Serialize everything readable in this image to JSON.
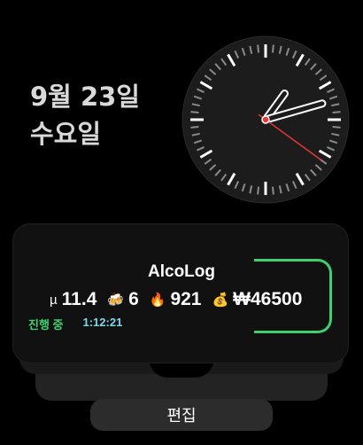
{
  "date": {
    "day": "9월 23일",
    "weekday": "수요일"
  },
  "clock": {
    "hours": 1,
    "minutes": 12,
    "seconds": 21,
    "accent": "#e53935"
  },
  "widget": {
    "title": "AlcoLog",
    "stats": [
      {
        "icon": "mu-icon",
        "glyph": "µ",
        "value": "11.4"
      },
      {
        "icon": "beer-mug-icon",
        "glyph": "🍻",
        "value": "6"
      },
      {
        "icon": "fire-icon",
        "glyph": "🔥",
        "value": "921"
      },
      {
        "icon": "money-bag-icon",
        "glyph": "💰",
        "value": "₩46500"
      }
    ],
    "status_label": "진행 중",
    "elapsed": "1:12:21",
    "accent": "#3fcf6e"
  },
  "edit_label": "편집"
}
